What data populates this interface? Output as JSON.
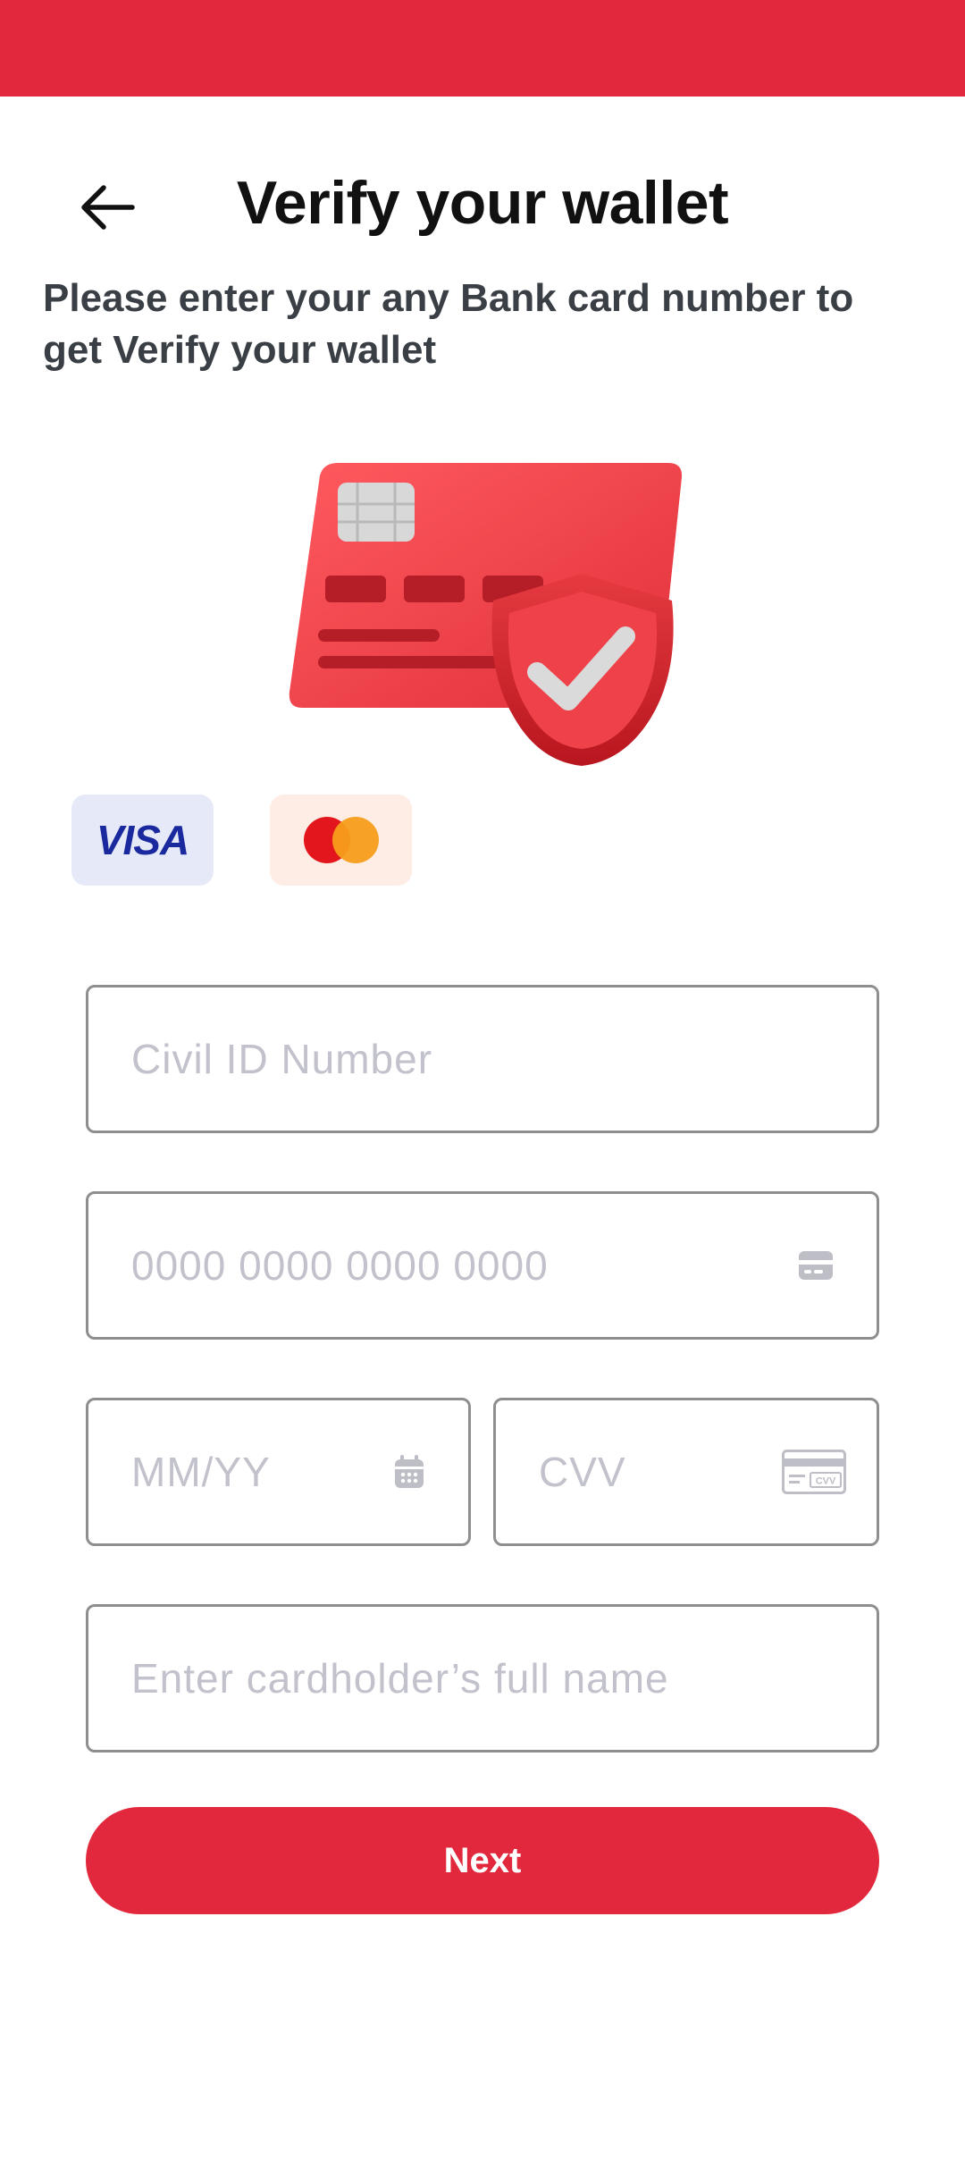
{
  "theme": {
    "accent": "#E1283D",
    "text": "#111111",
    "subtitle": "#3a3f45",
    "placeholder": "#c2c2cc",
    "border": "#8e8e8e"
  },
  "header": {
    "back_icon": "arrow-left-icon",
    "title": "Verify your wallet",
    "subtitle": "Please enter your any Bank card number to get Verify your wallet"
  },
  "hero": {
    "icon": "credit-card-shield-check-icon"
  },
  "brands": [
    {
      "name": "VISA",
      "icon": "visa-logo"
    },
    {
      "name": "Mastercard",
      "icon": "mastercard-logo"
    }
  ],
  "form": {
    "civil_id": {
      "placeholder": "Civil ID Number",
      "value": ""
    },
    "card_number": {
      "placeholder": "0000 0000 0000 0000",
      "value": "",
      "icon": "card-icon"
    },
    "expiry": {
      "placeholder": "MM/YY",
      "value": "",
      "icon": "calendar-icon"
    },
    "cvv": {
      "placeholder": "CVV",
      "value": "",
      "icon": "card-cvv-icon"
    },
    "cardholder": {
      "placeholder": "Enter cardholder’s full name",
      "value": ""
    }
  },
  "actions": {
    "next_label": "Next"
  }
}
